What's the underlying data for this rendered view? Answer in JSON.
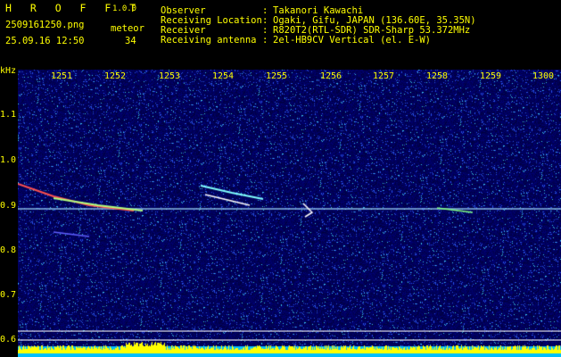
{
  "header": {
    "app_name": "H R O F F T",
    "version": "1.0.0",
    "filename": "2509161250.png",
    "timestamp": "25.09.16 12:50",
    "meteor_label": "meteor",
    "meteor_count": "34",
    "info": [
      {
        "label": "Observer",
        "value": "Takanori Kawachi"
      },
      {
        "label": "Receiving Location",
        "value": "Ogaki, Gifu, JAPAN (136.60E, 35.35N)"
      },
      {
        "label": "Receiver",
        "value": "R820T2(RTL-SDR) SDR-Sharp 53.372MHz"
      },
      {
        "label": "Receiving antenna",
        "value": "2el-HB9CV Vertical (el. E-W)"
      }
    ]
  },
  "chart_data": {
    "type": "heatmap",
    "ylabel": "kHz",
    "y_ticks": [
      "1.1",
      "1.0",
      "0.9",
      "0.8",
      "0.7",
      "0.6"
    ],
    "x_ticks": [
      "1251",
      "1252",
      "1253",
      "1254",
      "1255",
      "1256",
      "1257",
      "1258",
      "1259",
      "1300"
    ]
  }
}
